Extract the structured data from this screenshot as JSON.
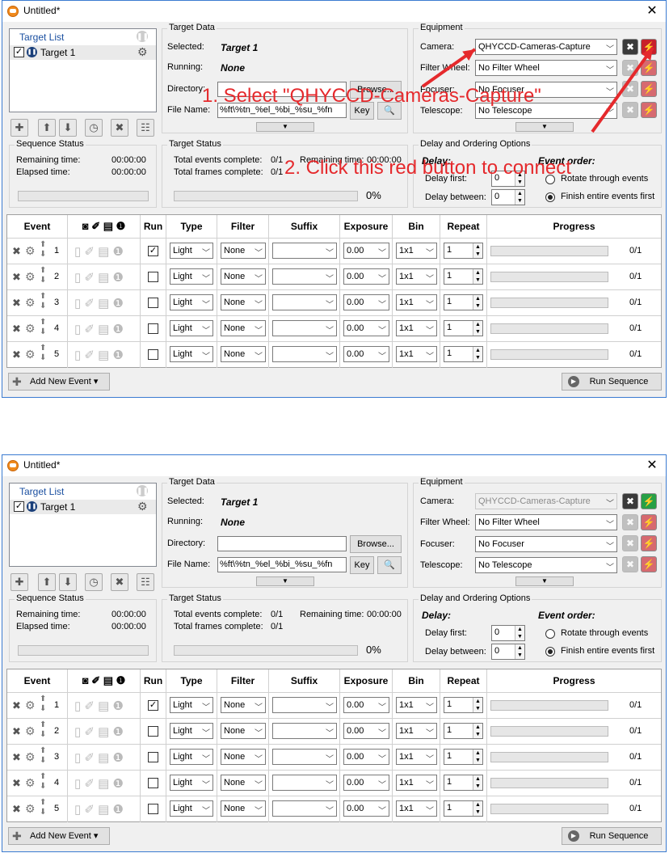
{
  "window": {
    "title": "Untitled*"
  },
  "target_list": {
    "title": "Target List",
    "items": [
      {
        "name": "Target 1",
        "checked": true
      }
    ]
  },
  "target_data": {
    "legend": "Target Data",
    "selected_label": "Selected:",
    "selected_value": "Target 1",
    "running_label": "Running:",
    "running_value": "None",
    "directory_label": "Directory:",
    "directory_value": "",
    "browse_label": "Browse...",
    "filename_label": "File Name:",
    "filename_value": "%ft\\%tn_%el_%bi_%su_%fn",
    "key_label": "Key"
  },
  "equipment": {
    "legend": "Equipment",
    "camera_label": "Camera:",
    "camera_value": "QHYCCD-Cameras-Capture",
    "filterwheel_label": "Filter Wheel:",
    "filterwheel_value": "No Filter Wheel",
    "focuser_label": "Focuser:",
    "focuser_value": "No Focuser",
    "telescope_label": "Telescope:",
    "telescope_value": "No Telescope"
  },
  "sequence_status": {
    "legend": "Sequence Status",
    "remaining_label": "Remaining time:",
    "remaining_value": "00:00:00",
    "elapsed_label": "Elapsed time:",
    "elapsed_value": "00:00:00",
    "progress": 0
  },
  "target_status": {
    "legend": "Target Status",
    "events_label": "Total events complete:",
    "events_value": "0/1",
    "frames_label": "Total frames complete:",
    "frames_value": "0/1",
    "remaining_label": "Remaining time:",
    "remaining_value": "00:00:00",
    "percent": "0%"
  },
  "delay": {
    "legend": "Delay and Ordering Options",
    "delay_heading": "Delay:",
    "order_heading": "Event order:",
    "first_label": "Delay first:",
    "first_value": "0",
    "between_label": "Delay between:",
    "between_value": "0",
    "rotate_label": "Rotate through events",
    "finish_label": "Finish entire events first",
    "selected": "finish"
  },
  "grid": {
    "headers": {
      "event": "Event",
      "run": "Run",
      "type": "Type",
      "filter": "Filter",
      "suffix": "Suffix",
      "exposure": "Exposure",
      "bin": "Bin",
      "repeat": "Repeat",
      "progress": "Progress"
    },
    "rows": [
      {
        "num": "1",
        "run": true,
        "type": "Light",
        "filter": "None",
        "suffix": "",
        "exposure": "0.00",
        "bin": "1x1",
        "repeat": "1",
        "progress": "0/1"
      },
      {
        "num": "2",
        "run": false,
        "type": "Light",
        "filter": "None",
        "suffix": "",
        "exposure": "0.00",
        "bin": "1x1",
        "repeat": "1",
        "progress": "0/1"
      },
      {
        "num": "3",
        "run": false,
        "type": "Light",
        "filter": "None",
        "suffix": "",
        "exposure": "0.00",
        "bin": "1x1",
        "repeat": "1",
        "progress": "0/1"
      },
      {
        "num": "4",
        "run": false,
        "type": "Light",
        "filter": "None",
        "suffix": "",
        "exposure": "0.00",
        "bin": "1x1",
        "repeat": "1",
        "progress": "0/1"
      },
      {
        "num": "5",
        "run": false,
        "type": "Light",
        "filter": "None",
        "suffix": "",
        "exposure": "0.00",
        "bin": "1x1",
        "repeat": "1",
        "progress": "0/1"
      }
    ]
  },
  "footer": {
    "add_event_label": "Add New Event",
    "run_sequence_label": "Run Sequence"
  },
  "annotations": {
    "step1": "1. Select \"QHYCCD-Cameras-Capture\"",
    "step2": "2. Click this red button to connect",
    "color": "#e5292c"
  },
  "icons": [
    "app-icon",
    "close-icon",
    "gear-icon",
    "pause-icon",
    "add-icon",
    "up-arrow-icon",
    "down-arrow-icon",
    "clock-icon",
    "delete-icon",
    "settings-icon",
    "search-icon",
    "chevron-down-icon",
    "disconnect-icon",
    "connect-icon",
    "play-icon"
  ]
}
